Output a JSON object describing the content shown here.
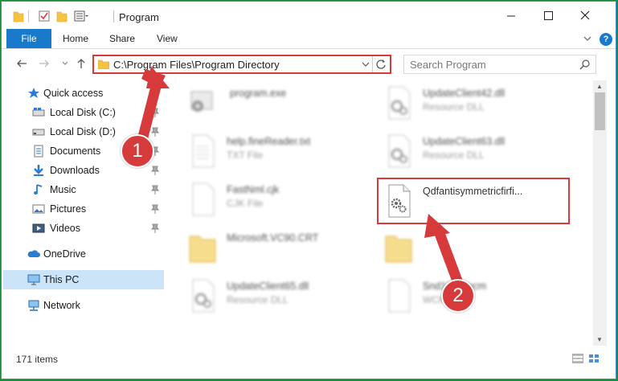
{
  "window": {
    "title": "Program",
    "controls": {
      "minimize": "minimize",
      "maximize": "maximize",
      "close": "close"
    }
  },
  "ribbon": {
    "tabs": [
      {
        "label": "File",
        "active": true
      },
      {
        "label": "Home"
      },
      {
        "label": "Share"
      },
      {
        "label": "View"
      }
    ],
    "help_label": "?"
  },
  "address": {
    "path": "C:\\Program Files\\Program Directory"
  },
  "search": {
    "placeholder": "Search Program"
  },
  "nav": {
    "items": [
      {
        "label": "Quick access",
        "icon": "star-icon",
        "pinned": false
      },
      {
        "label": "Local Disk (C:)",
        "icon": "drive-icon",
        "pinned": true
      },
      {
        "label": "Local Disk (D:)",
        "icon": "drive-icon",
        "pinned": true
      },
      {
        "label": "Documents",
        "icon": "documents-icon",
        "pinned": true
      },
      {
        "label": "Downloads",
        "icon": "download-icon",
        "pinned": true
      },
      {
        "label": "Music",
        "icon": "music-icon",
        "pinned": true
      },
      {
        "label": "Pictures",
        "icon": "pictures-icon",
        "pinned": true
      },
      {
        "label": "Videos",
        "icon": "videos-icon",
        "pinned": true
      },
      {
        "label": "OneDrive",
        "icon": "cloud-icon",
        "pinned": false
      },
      {
        "label": "This PC",
        "icon": "pc-icon",
        "pinned": false,
        "selected": true
      },
      {
        "label": "Network",
        "icon": "network-icon",
        "pinned": false
      }
    ]
  },
  "files": [
    {
      "name": "program.exe",
      "type": "",
      "icon": "exe-icon"
    },
    {
      "name": "UpdateClient42.dll",
      "type": "Resource DLL",
      "icon": "dll-icon"
    },
    {
      "name": "help.fineReader.txt",
      "type": "TXT File",
      "icon": "text-file-icon"
    },
    {
      "name": "UpdateClient63.dll",
      "type": "Resource DLL",
      "icon": "dll-icon"
    },
    {
      "name": "FastNml.cjk",
      "type": "CJK File",
      "icon": "blank-file-icon"
    },
    {
      "name": "Qdfantisymmetricfirfi...",
      "type": "",
      "icon": "dll-icon",
      "highlighted": true
    },
    {
      "name": "Microsoft.VC90.CRT",
      "type": "",
      "icon": "folder-icon"
    },
    {
      "name": "",
      "type": "",
      "icon": "folder-icon"
    },
    {
      "name": "UpdateClient65.dll",
      "type": "Resource DLL",
      "icon": "dll-icon"
    },
    {
      "name": "Snd1032.wcm",
      "type": "WCM File",
      "icon": "blank-file-icon"
    }
  ],
  "status": {
    "item_count": "171 items"
  },
  "annotations": {
    "step1": "1",
    "step2": "2",
    "color": "#d63a3a"
  },
  "colors": {
    "accent": "#1979ca",
    "selection": "#cce4f7",
    "background": "#1d8a3a"
  }
}
